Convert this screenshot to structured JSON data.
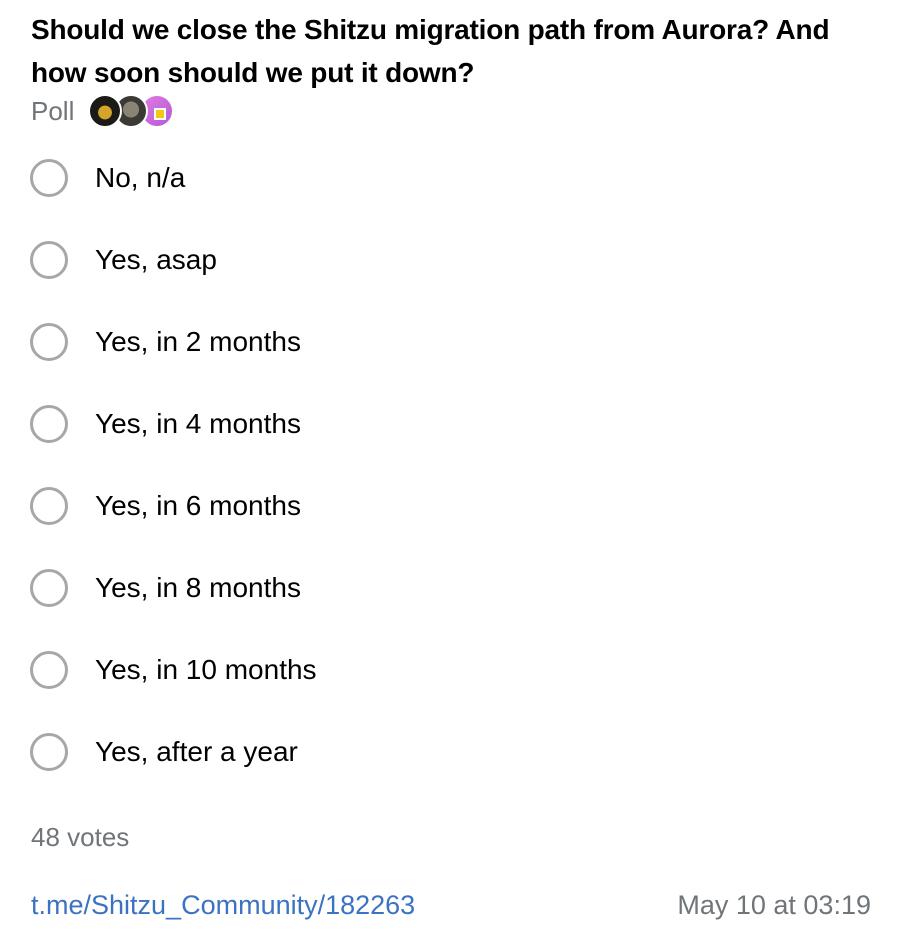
{
  "poll": {
    "question": "Should we close the Shitzu migration path from Aurora? And how soon should we put it down?",
    "type_label": "Poll",
    "options": [
      {
        "label": "No, n/a"
      },
      {
        "label": "Yes, asap"
      },
      {
        "label": "Yes, in 2 months"
      },
      {
        "label": "Yes, in 4 months"
      },
      {
        "label": "Yes, in 6 months"
      },
      {
        "label": "Yes, in 8 months"
      },
      {
        "label": "Yes, in 10 months"
      },
      {
        "label": "Yes, after a year"
      }
    ],
    "votes_text": "48 votes"
  },
  "footer": {
    "link_text": "t.me/Shitzu_Community/182263",
    "timestamp": "May 10 at 03:19"
  },
  "colors": {
    "accent_link": "#3b73c2",
    "muted_text": "#707579",
    "radio_border": "#a7a7a7"
  }
}
